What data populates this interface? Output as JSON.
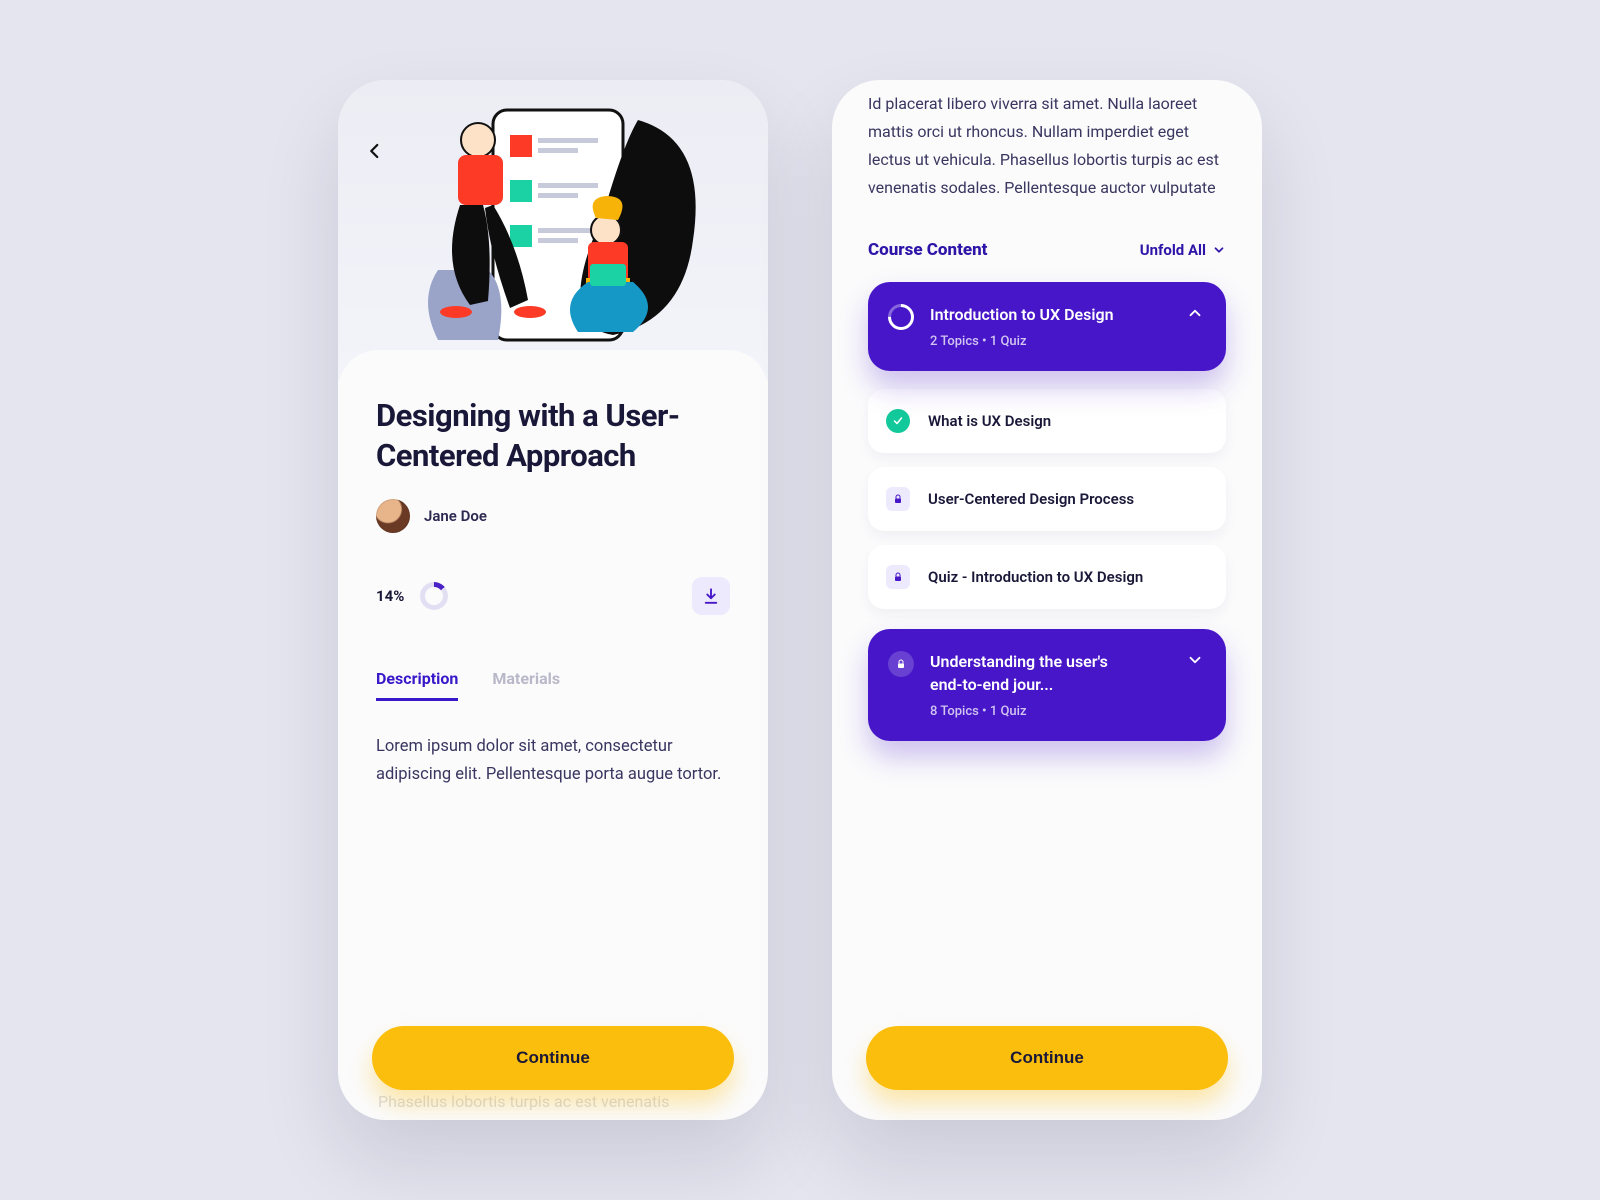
{
  "left": {
    "course_title": "Designing with a User-Centered Approach",
    "author": "Jane Doe",
    "progress_pct": "14%",
    "tabs": {
      "description": "Description",
      "materials": "Materials"
    },
    "description_text": "Lorem ipsum dolor sit amet, consectetur adipiscing elit. Pellentesque porta augue tortor.",
    "continue_label": "Continue",
    "faded_text": "imperdiet eget lectus ut vehicula.\nPhasellus lobortis turpis ac est venenatis"
  },
  "right": {
    "intro_para": "Id placerat libero viverra sit amet. Nulla laoreet mattis orci ut rhoncus. Nullam imperdiet eget lectus ut vehicula. Phasellus lobortis turpis ac est venenatis sodales. Pellentesque auctor vulputate",
    "cc_title": "Course Content",
    "unfold_label": "Unfold All",
    "section1": {
      "title": "Introduction to UX Design",
      "meta": "2 Topics • 1 Quiz"
    },
    "topics": {
      "t1": "What is UX Design",
      "t2": "User-Centered Design Process",
      "t3": "Quiz - Introduction to UX Design"
    },
    "section2": {
      "title": "Understanding the user's end-to-end jour...",
      "meta": "8 Topics • 1 Quiz"
    },
    "continue_label": "Continue"
  },
  "colors": {
    "primary": "#4716c8",
    "accent": "#fbbe0c",
    "success": "#12c99b"
  }
}
